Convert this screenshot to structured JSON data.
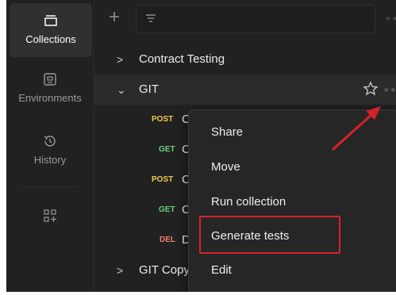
{
  "rail": {
    "items": [
      {
        "label": "Collections",
        "icon": "collections-icon",
        "active": true
      },
      {
        "label": "Environments",
        "icon": "environments-icon",
        "active": false
      },
      {
        "label": "History",
        "icon": "history-icon",
        "active": false
      },
      {
        "label": "",
        "icon": "add-workspace-icon",
        "active": false
      }
    ]
  },
  "toolbar": {
    "new_icon": "plus-icon",
    "filter_icon": "filter-icon",
    "more_label": "∘∘"
  },
  "tree": {
    "collections": [
      {
        "name": "Contract Testing",
        "expanded": false
      },
      {
        "name": "GIT",
        "expanded": true
      },
      {
        "name": "GIT Copy",
        "expanded": false
      }
    ],
    "requests": [
      {
        "method": "POST",
        "name": "Cr"
      },
      {
        "method": "GET",
        "name": "Co"
      },
      {
        "method": "POST",
        "name": "Cr"
      },
      {
        "method": "GET",
        "name": "Co"
      },
      {
        "method": "DEL",
        "name": "De"
      }
    ],
    "git_more_label": "∘∘"
  },
  "context_menu": {
    "items": [
      "Share",
      "Move",
      "Run collection",
      "Generate tests",
      "Edit"
    ],
    "highlighted": "Generate tests"
  },
  "colors": {
    "annotation_red": "#d4232a",
    "post": "#f2c94c",
    "get": "#6ccf7f",
    "del": "#f07f6e"
  }
}
